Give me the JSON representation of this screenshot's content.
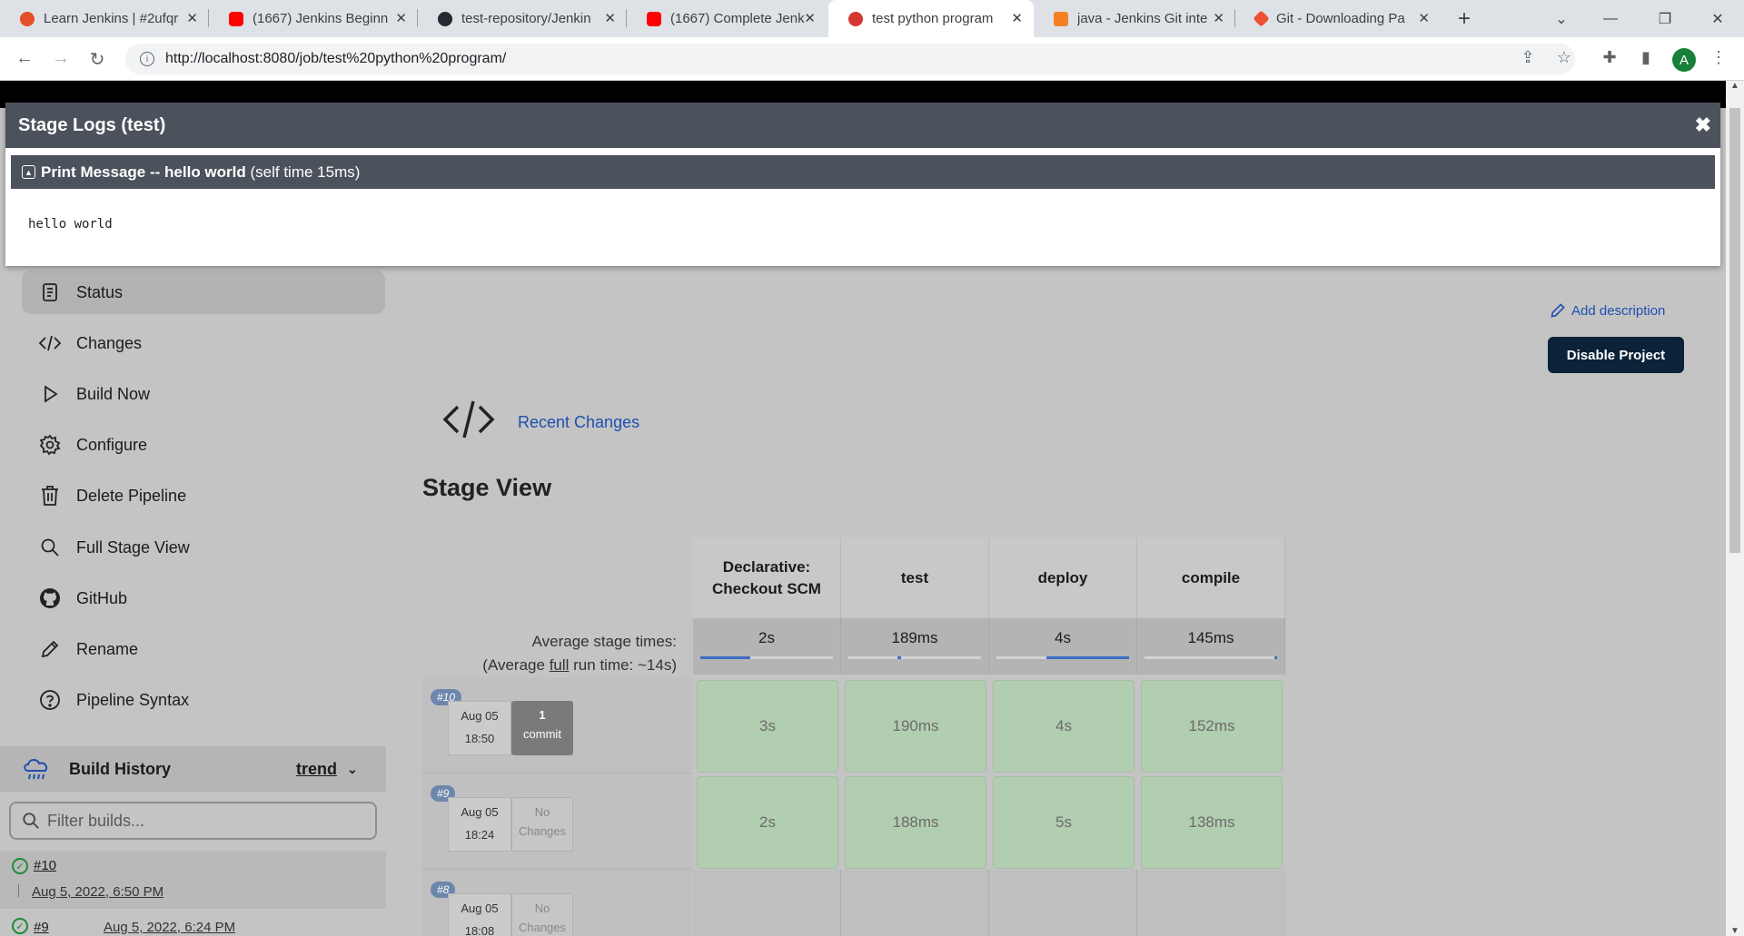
{
  "browser": {
    "tabs": [
      {
        "title": "Learn Jenkins | #2ufqr",
        "favicon": "cypress-favicon",
        "color": "#e34f26"
      },
      {
        "title": "(1667) Jenkins Beginn",
        "favicon": "youtube-favicon",
        "color": "#ff0000"
      },
      {
        "title": "test-repository/Jenkin",
        "favicon": "github-favicon",
        "color": "#24292f"
      },
      {
        "title": "(1667) Complete Jenk",
        "favicon": "youtube-favicon",
        "color": "#ff0000"
      },
      {
        "title": "test python program",
        "favicon": "jenkins-favicon",
        "color": "#d33833"
      },
      {
        "title": "java - Jenkins Git inte",
        "favicon": "stackoverflow-favicon",
        "color": "#f48024"
      },
      {
        "title": "Git - Downloading Pa",
        "favicon": "git-favicon",
        "color": "#f05033"
      }
    ],
    "url": "http://localhost:8080/job/test%20python%20program/",
    "profile_initial": "A"
  },
  "modal": {
    "title": "Stage Logs (test)",
    "step_title": "Print Message -- hello world",
    "step_time": "(self time 15ms)",
    "log": "hello world"
  },
  "sidebar": {
    "items": [
      {
        "label": "Status",
        "icon": "status-icon"
      },
      {
        "label": "Changes",
        "icon": "code-icon"
      },
      {
        "label": "Build Now",
        "icon": "play-icon"
      },
      {
        "label": "Configure",
        "icon": "gear-icon"
      },
      {
        "label": "Delete Pipeline",
        "icon": "trash-icon"
      },
      {
        "label": "Full Stage View",
        "icon": "search-icon"
      },
      {
        "label": "GitHub",
        "icon": "github-icon"
      },
      {
        "label": "Rename",
        "icon": "pencil-icon"
      },
      {
        "label": "Pipeline Syntax",
        "icon": "help-icon"
      }
    ],
    "build_history": {
      "title": "Build History",
      "trend": "trend",
      "filter_placeholder": "Filter builds...",
      "builds": [
        {
          "number": "#10",
          "date": "Aug 5, 2022, 6:50 PM"
        },
        {
          "number": "#9",
          "date": "Aug 5, 2022, 6:24 PM"
        }
      ]
    }
  },
  "main": {
    "add_description": "Add description",
    "disable_project": "Disable Project",
    "recent_changes": "Recent Changes",
    "stage_view_title": "Stage View",
    "avg_label_1": "Average stage times:",
    "avg_label_2_prefix": "(Average ",
    "avg_label_2_link": "full",
    "avg_label_2_suffix": " run time: ~14s)",
    "stages": [
      {
        "name": "Declarative: Checkout SCM",
        "avg": "2s",
        "avg_fraction": 0.38,
        "avg_offset": 0.0
      },
      {
        "name": "test",
        "avg": "189ms",
        "avg_fraction": 0.03,
        "avg_offset": 0.37
      },
      {
        "name": "deploy",
        "avg": "4s",
        "avg_fraction": 0.62,
        "avg_offset": 0.38
      },
      {
        "name": "compile",
        "avg": "145ms",
        "avg_fraction": 0.02,
        "avg_offset": 0.98
      }
    ],
    "runs": [
      {
        "badge": "#10",
        "date": "Aug 05",
        "time": "18:50",
        "changes_1": "1",
        "changes_2": "commit",
        "cells": [
          "3s",
          "190ms",
          "4s",
          "152ms"
        ]
      },
      {
        "badge": "#9",
        "date": "Aug 05",
        "time": "18:24",
        "changes_1": "No",
        "changes_2": "Changes",
        "cells": [
          "2s",
          "188ms",
          "5s",
          "138ms"
        ]
      },
      {
        "badge": "#8",
        "date": "Aug 05",
        "time": "18:08",
        "changes_1": "No",
        "changes_2": "Changes",
        "cells": []
      }
    ]
  }
}
